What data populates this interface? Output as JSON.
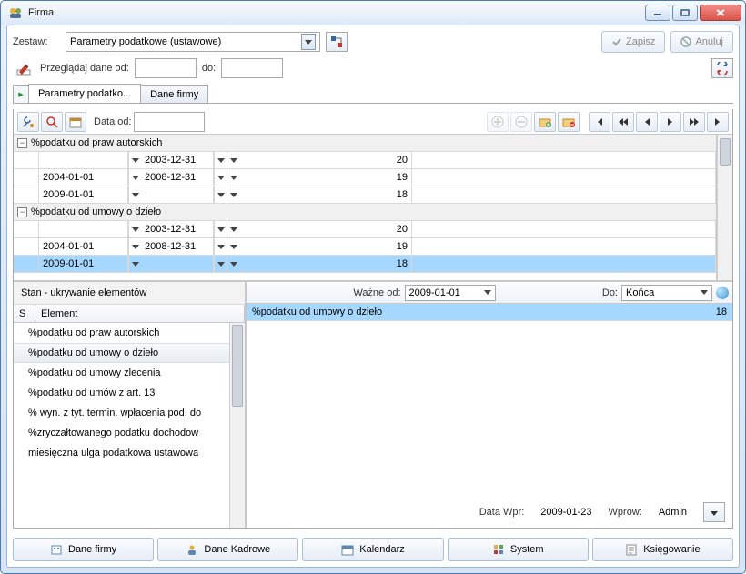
{
  "window": {
    "title": "Firma"
  },
  "top": {
    "zestaw_label": "Zestaw:",
    "zestaw_value": "Parametry podatkowe (ustawowe)",
    "save_label": "Zapisz",
    "cancel_label": "Anuluj",
    "browse_label": "Przeglądaj dane od:",
    "do_label": "do:"
  },
  "tabs": {
    "t1": "Parametry podatko...",
    "t2": "Dane firmy"
  },
  "toolbar": {
    "date_from_label": "Data od:"
  },
  "groups": [
    {
      "name": "%podatku od praw autorskich",
      "rows": [
        {
          "from": "",
          "to": "2003-12-31",
          "val": "20"
        },
        {
          "from": "2004-01-01",
          "to": "2008-12-31",
          "val": "19"
        },
        {
          "from": "2009-01-01",
          "to": "",
          "val": "18"
        }
      ]
    },
    {
      "name": "%podatku od umowy o dzieło",
      "rows": [
        {
          "from": "",
          "to": "2003-12-31",
          "val": "20"
        },
        {
          "from": "2004-01-01",
          "to": "2008-12-31",
          "val": "19"
        },
        {
          "from": "2009-01-01",
          "to": "",
          "val": "18"
        }
      ]
    }
  ],
  "left": {
    "title": "Stan - ukrywanie elementów",
    "col_s": "S",
    "col_el": "Element",
    "items": [
      "%podatku od praw autorskich",
      "%podatku od umowy o dzieło",
      "%podatku od umowy zlecenia",
      "%podatku od umów z art. 13",
      "% wyn. z tyt. termin. wpłacenia pod. do",
      "%zryczałtowanego podatku dochodow",
      "miesięczna ulga podatkowa ustawowa"
    ],
    "selected_index": 1
  },
  "right": {
    "wazne_label": "Ważne od:",
    "wazne_value": "2009-01-01",
    "do_label": "Do:",
    "do_value": "Końca",
    "row_name": "%podatku od umowy o dzieło",
    "row_val": "18"
  },
  "footer": {
    "data_wpr_label": "Data Wpr:",
    "data_wpr_value": "2009-01-23",
    "wprow_label": "Wprow:",
    "wprow_value": "Admin"
  },
  "bottom": {
    "b1": "Dane firmy",
    "b2": "Dane Kadrowe",
    "b3": "Kalendarz",
    "b4": "System",
    "b5": "Księgowanie"
  }
}
